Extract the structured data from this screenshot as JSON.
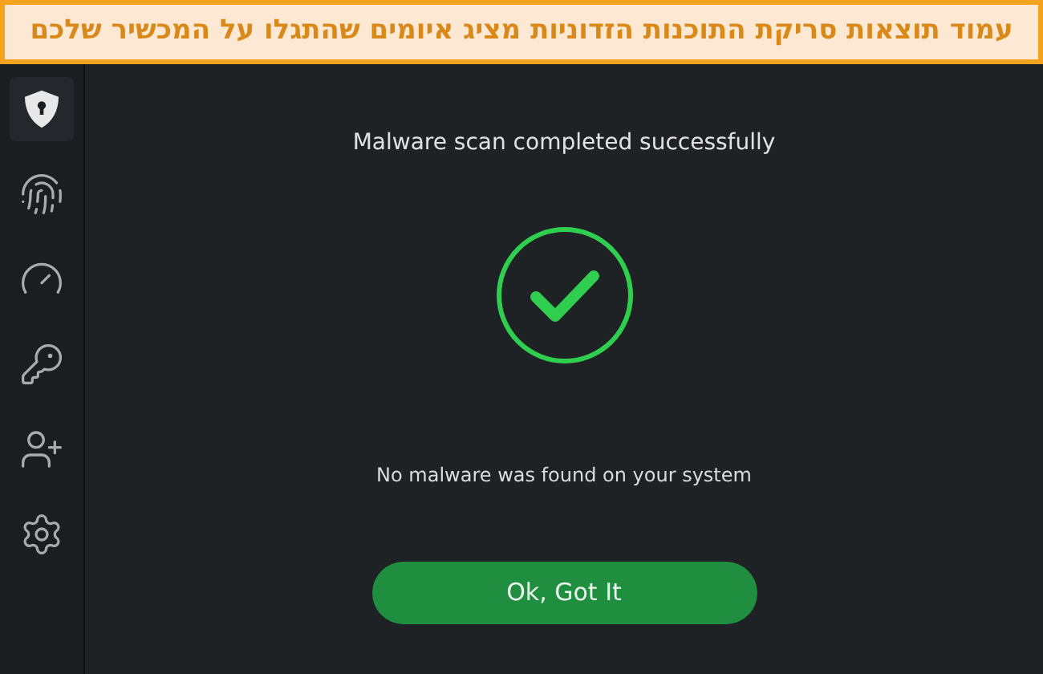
{
  "banner": {
    "text": "עמוד תוצאות סריקת התוכנות הזדוניות מציג איומים שהתגלו על המכשיר שלכם"
  },
  "sidebar": {
    "items": [
      {
        "kind": "shield",
        "selected": true
      },
      {
        "kind": "fingerprint",
        "selected": false
      },
      {
        "kind": "gauge",
        "selected": false
      },
      {
        "kind": "key",
        "selected": false
      },
      {
        "kind": "user-plus",
        "selected": false
      },
      {
        "kind": "settings",
        "selected": false
      }
    ]
  },
  "main": {
    "title": "Malware scan completed successfully",
    "message": "No malware was found on your system",
    "button": "Ok, Got It"
  }
}
